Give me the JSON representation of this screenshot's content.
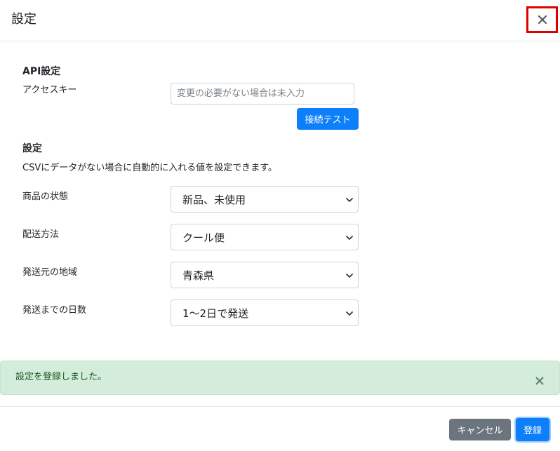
{
  "modal": {
    "title": "設定",
    "close_icon": "close-icon"
  },
  "api": {
    "section_title": "API設定",
    "access_key_label": "アクセスキー",
    "access_key_value": "",
    "access_key_placeholder": "変更の必要がない場合は未入力",
    "test_button_label": "接続テスト"
  },
  "settings": {
    "section_title": "設定",
    "description": "CSVにデータがない場合に自動的に入れる値を設定できます。",
    "fields": [
      {
        "label": "商品の状態",
        "selected": "新品、未使用"
      },
      {
        "label": "配送方法",
        "selected": "クール便"
      },
      {
        "label": "発送元の地域",
        "selected": "青森県"
      },
      {
        "label": "発送までの日数",
        "selected": "1〜2日で発送"
      }
    ]
  },
  "alert": {
    "message": "設定を登録しました。",
    "close_icon": "close-icon"
  },
  "footer": {
    "cancel_label": "キャンセル",
    "register_label": "登録"
  },
  "colors": {
    "primary": "#0d7ffb",
    "secondary": "#6c757d",
    "success_bg": "#d4edda",
    "success_text": "#155724",
    "highlight_border": "#e00000"
  }
}
